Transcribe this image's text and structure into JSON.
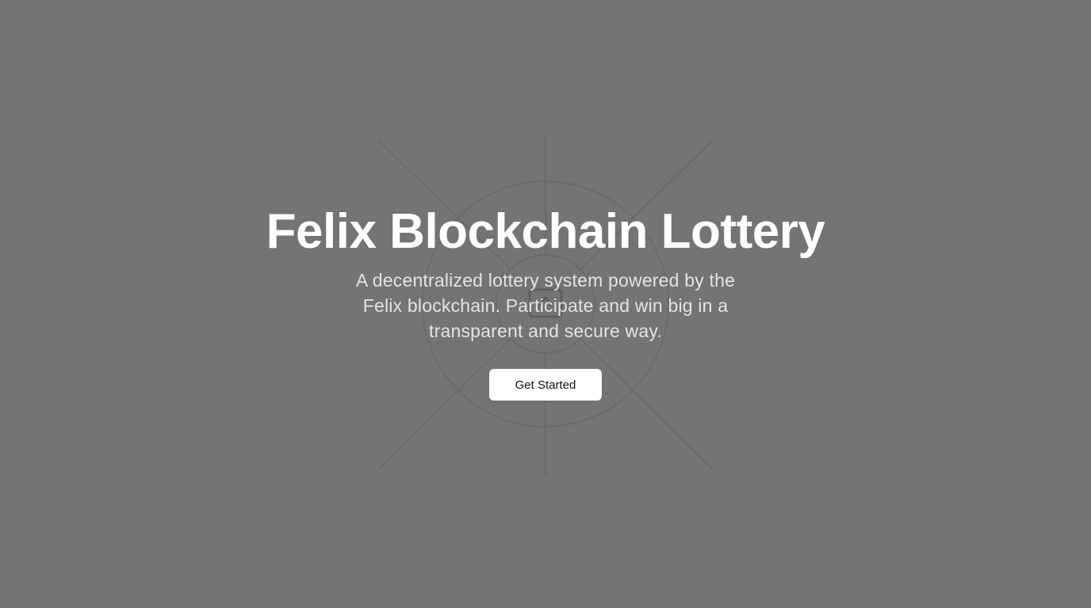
{
  "hero": {
    "title": "Felix Blockchain Lottery",
    "subtitle": "A decentralized lottery system powered by the Felix blockchain. Participate and win big in a transparent and secure way.",
    "cta_label": "Get Started",
    "center_icon": "image-placeholder-icon"
  },
  "colors": {
    "background": "#747474",
    "title": "#ffffff",
    "subtitle": "#e4e4e4",
    "button_bg": "#ffffff",
    "button_text": "#111111",
    "decoration_lines": "#6a6a6a"
  }
}
